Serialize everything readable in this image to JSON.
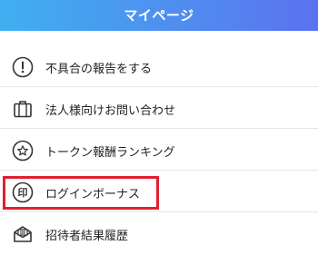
{
  "header": {
    "title": "マイページ",
    "gradient_colors": [
      "#3fb0f0",
      "#5a72ef"
    ]
  },
  "menu": {
    "items": [
      {
        "label": "不具合の報告をする",
        "icon": "exclamation-circle-icon"
      },
      {
        "label": "法人様向けお問い合わせ",
        "icon": "briefcase-icon"
      },
      {
        "label": "トークン報酬ランキング",
        "icon": "star-circle-icon"
      },
      {
        "label": "ログインボーナス",
        "icon": "seal-stamp-icon",
        "highlighted": true
      },
      {
        "label": "招待者結果履歴",
        "icon": "mail-icon"
      }
    ]
  },
  "highlight_color": "#e02030"
}
